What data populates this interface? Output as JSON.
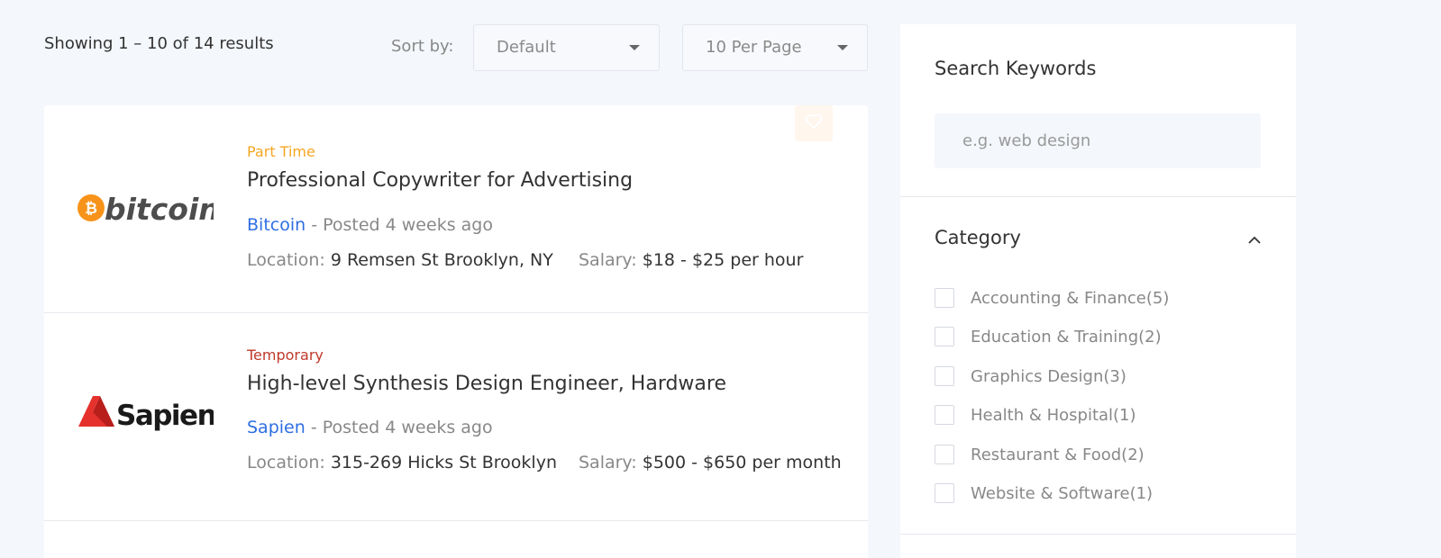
{
  "toolbar": {
    "results_text": "Showing 1 – 10 of 14 results",
    "sort_label": "Sort by:",
    "sort_value": "Default",
    "per_page_value": "10 Per Page"
  },
  "jobs": [
    {
      "type": "Part Time",
      "type_color": "#f5a623",
      "title": "Professional Copywriter for Advertising",
      "company": "Bitcoin",
      "posted": "- Posted 4 weeks ago",
      "location_label": "Location:",
      "location": "9 Remsen St Brooklyn, NY",
      "salary_label": "Salary:",
      "salary": "$18 - $25 per hour",
      "logo": {
        "name": "bitcoin-logo",
        "text": "bitcoin",
        "accent": "#f7931a"
      }
    },
    {
      "type": "Temporary",
      "type_color": "#c0392b",
      "title": "High-level Synthesis Design Engineer, Hardware",
      "company": "Sapien",
      "posted": "- Posted 4 weeks ago",
      "location_label": "Location:",
      "location": "315-269 Hicks St Brooklyn",
      "salary_label": "Salary:",
      "salary": "$500 - $650 per month",
      "logo": {
        "name": "sapient-logo",
        "text": "Sapient",
        "accent": "#e5322d"
      }
    }
  ],
  "sidebar": {
    "search_heading": "Search Keywords",
    "search_placeholder": "e.g. web design",
    "category_heading": "Category",
    "categories": [
      {
        "label": "Accounting & Finance(5)",
        "checked": false
      },
      {
        "label": "Education & Training(2)",
        "checked": false
      },
      {
        "label": "Graphics Design(3)",
        "checked": false
      },
      {
        "label": "Health & Hospital(1)",
        "checked": false
      },
      {
        "label": "Restaurant & Food(2)",
        "checked": false
      },
      {
        "label": "Website & Software(1)",
        "checked": false
      }
    ]
  },
  "colors": {
    "link": "#2e6fe2",
    "background": "#f4f7fb"
  }
}
